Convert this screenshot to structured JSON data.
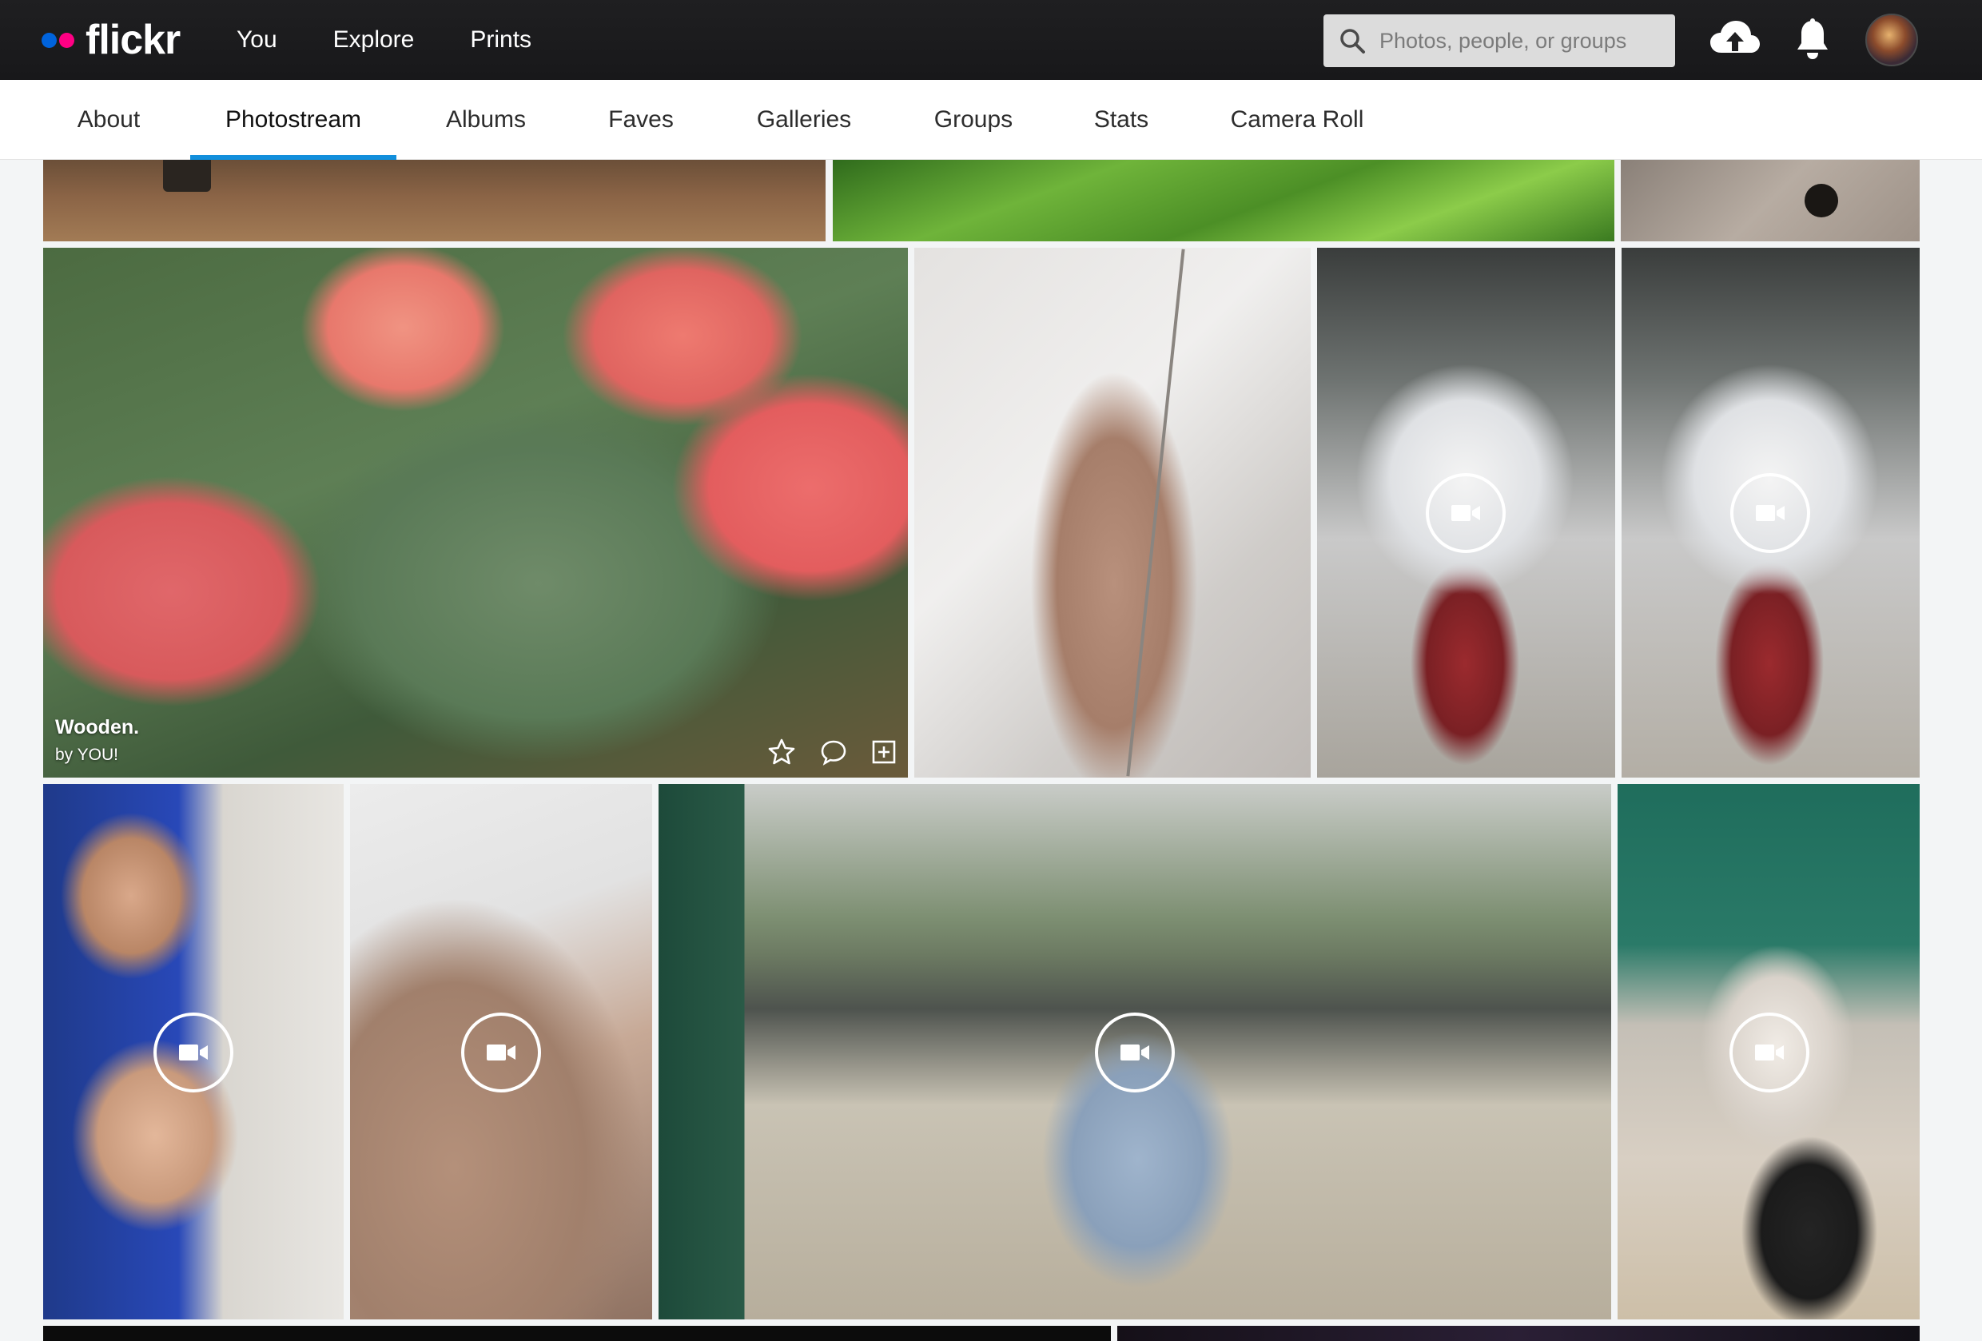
{
  "brand": {
    "name": "flickr"
  },
  "topnav": {
    "items": [
      "You",
      "Explore",
      "Prints"
    ]
  },
  "search": {
    "placeholder": "Photos, people, or groups"
  },
  "icons": {
    "upload": "cloud-upload-icon",
    "notifications": "bell-icon",
    "search": "search-icon",
    "video": "video-camera-icon",
    "fave": "star-icon",
    "comment": "speech-bubble-icon",
    "add": "plus-square-icon"
  },
  "subnav": {
    "tabs": [
      "About",
      "Photostream",
      "Albums",
      "Faves",
      "Galleries",
      "Groups",
      "Stats",
      "Camera Roll"
    ],
    "active": "Photostream"
  },
  "photos": {
    "featured": {
      "title": "Wooden.",
      "byline": "by YOU!"
    }
  },
  "colors": {
    "topbar": "#1f1f21",
    "accent_underline": "#128fdc",
    "logo_blue": "#0063dc",
    "logo_pink": "#ff0084"
  }
}
